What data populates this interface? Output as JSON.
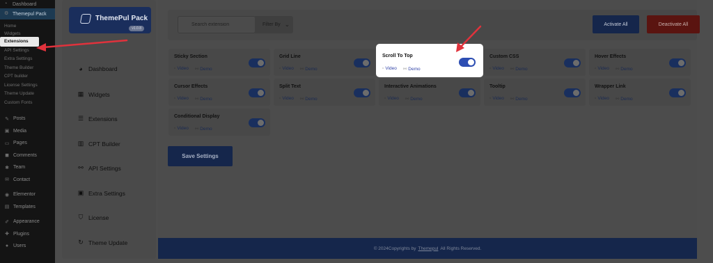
{
  "wp_sidebar": {
    "dashboard": "Dashboard",
    "plugin_menu": "Themepul Pack",
    "submenu": [
      "Home",
      "Widgets",
      "Extensions",
      "API Settings",
      "Extra Settings",
      "Theme Builder",
      "CPT builder",
      "License Settings",
      "Theme Update",
      "Custom Fonts"
    ],
    "menu": [
      "Posts",
      "Media",
      "Pages",
      "Comments",
      "Team",
      "Contact",
      "Elementor",
      "Templates",
      "Appearance",
      "Plugins",
      "Users"
    ]
  },
  "logo": {
    "text": "ThemePul Pack",
    "version": "v1.0.8"
  },
  "plugin_nav": [
    "Dashboard",
    "Widgets",
    "Extensions",
    "CPT Builder",
    "API Settings",
    "Extra Settings",
    "License",
    "Theme Update"
  ],
  "toolbar": {
    "search_placeholder": "Search extension",
    "filter_label": "Filter By",
    "activate_label": "Activate All",
    "deactivate_label": "Deactivate All"
  },
  "extensions": [
    {
      "title": "Sticky Section",
      "video": "Video",
      "demo": "Demo",
      "enabled": true
    },
    {
      "title": "Grid Line",
      "video": "Video",
      "demo": "Demo",
      "enabled": true
    },
    {
      "title": "Scroll To Top",
      "video": "Video",
      "demo": "Demo",
      "enabled": true
    },
    {
      "title": "Custom CSS",
      "video": "Video",
      "demo": "Demo",
      "enabled": true
    },
    {
      "title": "Hover Effects",
      "video": "Video",
      "demo": "Demo",
      "enabled": true
    },
    {
      "title": "Cursor Effects",
      "video": "Video",
      "demo": "Demo",
      "enabled": true
    },
    {
      "title": "Split Text",
      "video": "Video",
      "demo": "Demo",
      "enabled": true
    },
    {
      "title": "Interactive Animations",
      "video": "Video",
      "demo": "Demo",
      "enabled": true
    },
    {
      "title": "Tooltip",
      "video": "Video",
      "demo": "Demo",
      "enabled": true
    },
    {
      "title": "Wrapper Link",
      "video": "Video",
      "demo": "Demo",
      "enabled": true
    },
    {
      "title": "Conditional Display",
      "video": "Video",
      "demo": "Demo",
      "enabled": true
    }
  ],
  "save_label": "Save Settings",
  "footer": {
    "prefix": "© 2024Copyrights by",
    "brand": "Themepul",
    "suffix": "All Rights Reserved."
  },
  "colors": {
    "primary": "#15264b",
    "danger": "#5a1410",
    "highlight_toggle": "#2d4eb3",
    "annotation_arrow": "#e0323c"
  }
}
